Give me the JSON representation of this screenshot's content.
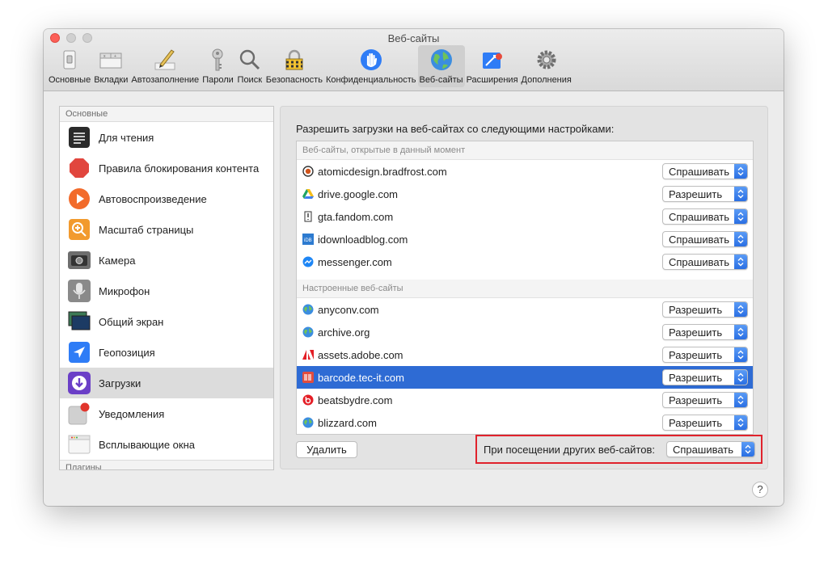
{
  "window": {
    "title": "Веб-сайты"
  },
  "toolbar": [
    {
      "label": "Основные",
      "icon": "general-icon"
    },
    {
      "label": "Вкладки",
      "icon": "tabs-icon"
    },
    {
      "label": "Автозаполнение",
      "icon": "autofill-pencil-icon"
    },
    {
      "label": "Пароли",
      "icon": "key-icon"
    },
    {
      "label": "Поиск",
      "icon": "magnifier-icon"
    },
    {
      "label": "Безопасность",
      "icon": "security-lock-icon"
    },
    {
      "label": "Конфиденциальность",
      "icon": "privacy-hand-icon"
    },
    {
      "label": "Веб-сайты",
      "icon": "globe-icon",
      "active": true
    },
    {
      "label": "Расширения",
      "icon": "extensions-puzzle-icon"
    },
    {
      "label": "Дополнения",
      "icon": "advanced-gear-icon"
    }
  ],
  "sidebar": {
    "header": "Основные",
    "items": [
      {
        "label": "Для чтения",
        "icon": "reader-icon"
      },
      {
        "label": "Правила блокирования контента",
        "icon": "content-blocker-icon"
      },
      {
        "label": "Автовоспроизведение",
        "icon": "autoplay-icon"
      },
      {
        "label": "Масштаб страницы",
        "icon": "page-zoom-icon"
      },
      {
        "label": "Камера",
        "icon": "camera-icon"
      },
      {
        "label": "Микрофон",
        "icon": "microphone-icon"
      },
      {
        "label": "Общий экран",
        "icon": "screen-sharing-icon"
      },
      {
        "label": "Геопозиция",
        "icon": "location-icon"
      },
      {
        "label": "Загрузки",
        "icon": "downloads-icon",
        "selected": true
      },
      {
        "label": "Уведомления",
        "icon": "notifications-icon"
      },
      {
        "label": "Всплывающие окна",
        "icon": "popup-windows-icon"
      }
    ],
    "footer": "Плагины"
  },
  "main": {
    "heading": "Разрешить загрузки на веб-сайтах со следующими настройками:",
    "groups": [
      {
        "title": "Веб-сайты, открытые в данный момент",
        "sites": [
          {
            "domain": "atomicdesign.bradfrost.com",
            "value": "Спрашивать"
          },
          {
            "domain": "drive.google.com",
            "value": "Разрешить"
          },
          {
            "domain": "gta.fandom.com",
            "value": "Спрашивать"
          },
          {
            "domain": "idownloadblog.com",
            "value": "Спрашивать"
          },
          {
            "domain": "messenger.com",
            "value": "Спрашивать"
          }
        ]
      },
      {
        "title": "Настроенные веб-сайты",
        "sites": [
          {
            "domain": "anyconv.com",
            "value": "Разрешить"
          },
          {
            "domain": "archive.org",
            "value": "Разрешить"
          },
          {
            "domain": "assets.adobe.com",
            "value": "Разрешить"
          },
          {
            "domain": "barcode.tec-it.com",
            "value": "Разрешить",
            "selected": true
          },
          {
            "domain": "beatsbydre.com",
            "value": "Разрешить"
          },
          {
            "domain": "blizzard.com",
            "value": "Разрешить"
          }
        ]
      }
    ],
    "remove_button": "Удалить",
    "other_sites_label": "При посещении других веб-сайтов:",
    "other_sites_value": "Спрашивать",
    "help": "?"
  }
}
